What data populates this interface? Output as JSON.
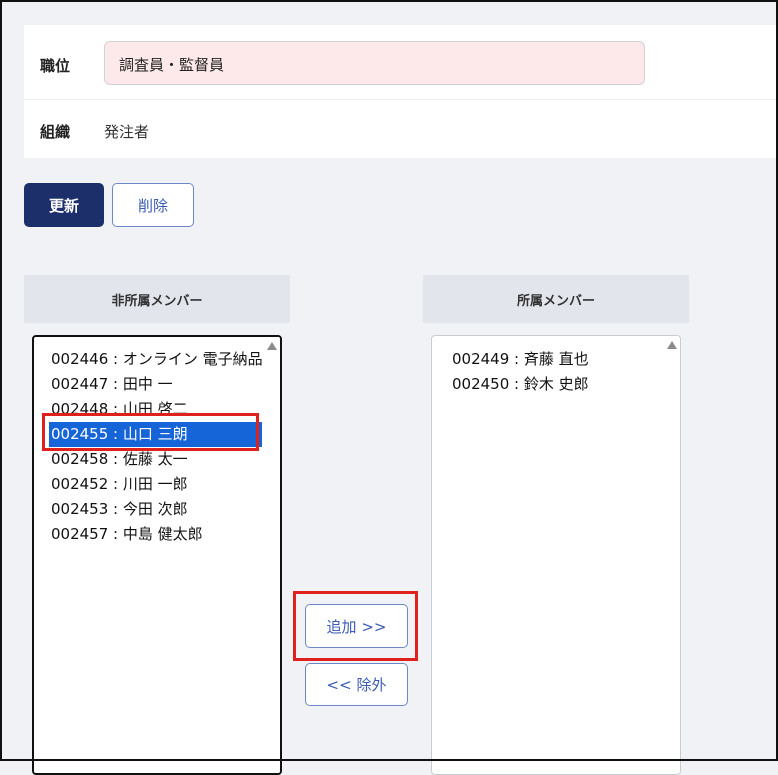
{
  "form": {
    "position_label": "職位",
    "position_value": "調査員・監督員",
    "org_label": "組織",
    "org_value": "発注者"
  },
  "actions": {
    "update_label": "更新",
    "delete_label": "削除"
  },
  "nonmembers": {
    "header": "非所属メンバー",
    "items": [
      "002446 : オンライン 電子納品",
      "002447 : 田中 一",
      "002448 : 山田 啓二",
      "002455 : 山口 三朗",
      "002458 : 佐藤 太一",
      "002452 : 川田 一郎",
      "002453 : 今田 次郎",
      "002457 : 中島 健太郎"
    ],
    "selected": "002455 : 山口 三朗"
  },
  "members": {
    "header": "所属メンバー",
    "items": [
      "002449 : 斉藤 直也",
      "002450 : 鈴木 史郎"
    ]
  },
  "transfer": {
    "add_label": "追加 >>",
    "remove_label": "<< 除外"
  },
  "colors": {
    "primary": "#1c2f6b",
    "link": "#3a5bb5",
    "selection": "#1565d8",
    "highlight": "#e0201c",
    "position_bg": "#fde8ea"
  }
}
